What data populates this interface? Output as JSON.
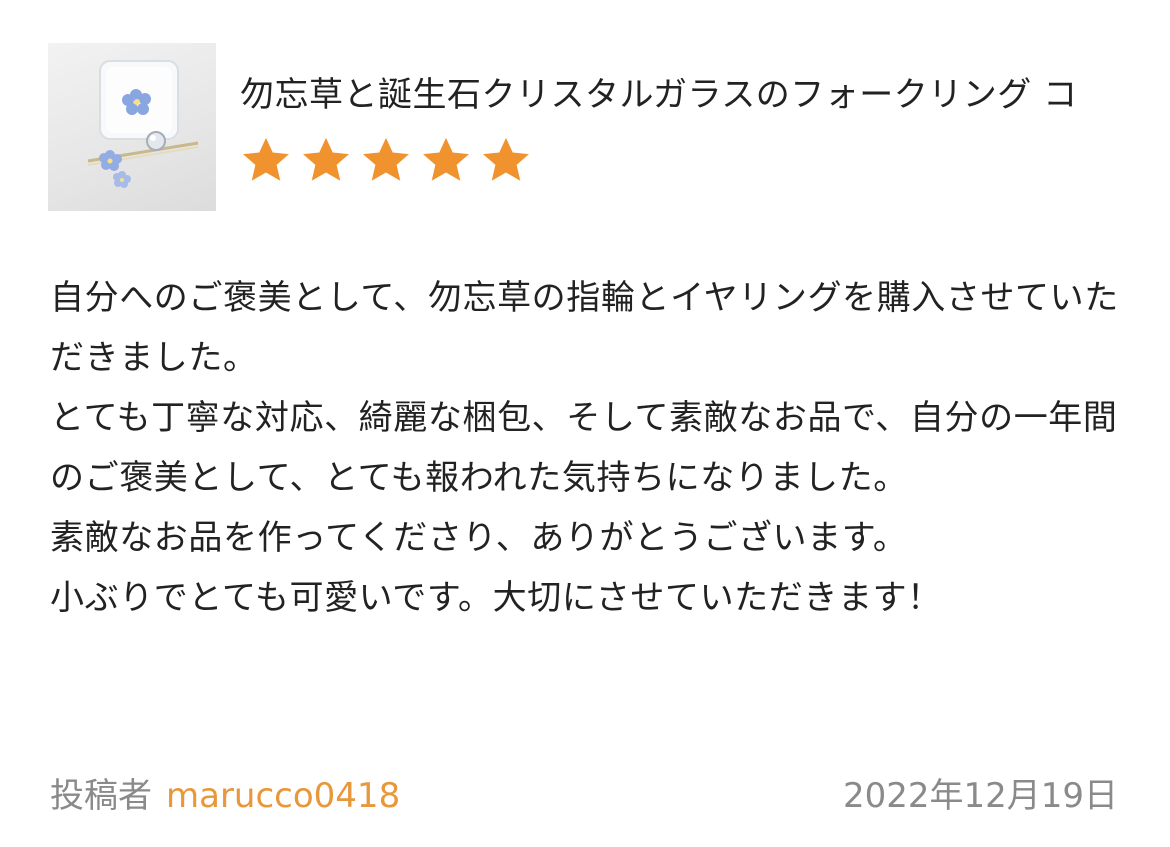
{
  "product": {
    "title": "勿忘草と誕生石クリスタルガラスのフォークリング コ",
    "rating": 5,
    "rating_max": 5,
    "star_color": "#f0922e",
    "thumbnail_icon": "product-photo"
  },
  "review": {
    "paragraphs": [
      "自分へのご褒美として、勿忘草の指輪とイヤリングを購入させていただきました。",
      "とても丁寧な対応、綺麗な梱包、そして素敵なお品で、自分の一年間のご褒美として、とても報われた気持ちになりました。",
      "素敵なお品を作ってくださり、ありがとうございます。",
      "小ぶりでとても可愛いです。大切にさせていただきます！"
    ]
  },
  "footer": {
    "poster_label": "投稿者",
    "poster_name": "marucco0418",
    "date": "2022年12月19日",
    "name_color": "#e8973a"
  }
}
